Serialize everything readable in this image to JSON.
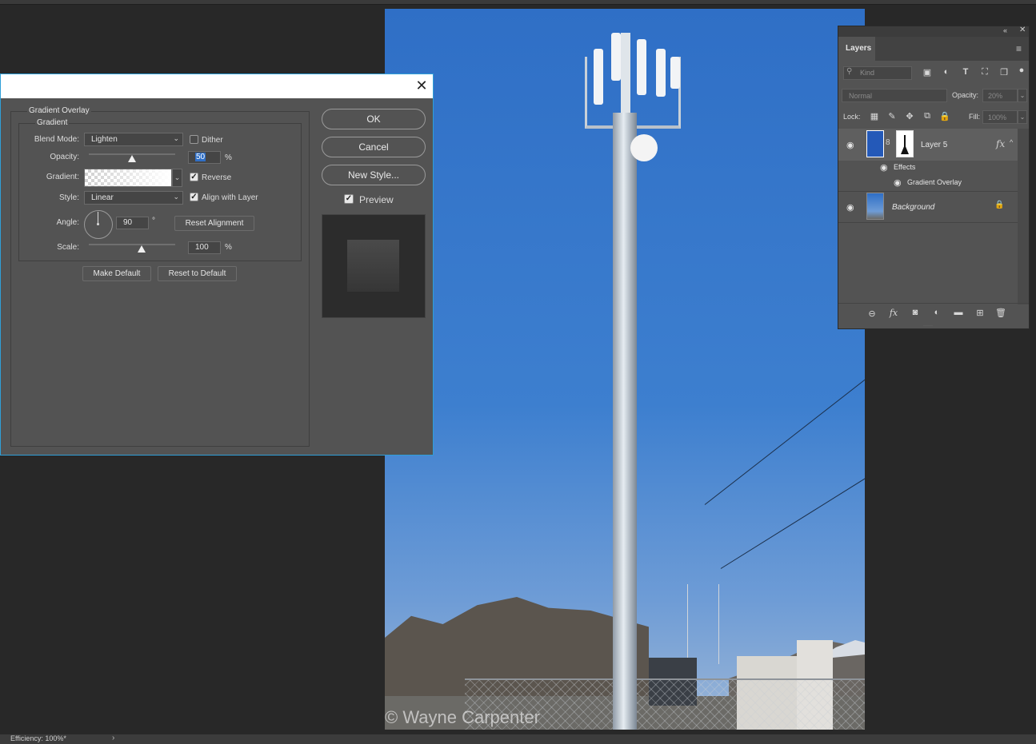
{
  "canvas": {
    "watermark": "© Wayne Carpenter"
  },
  "status_bar": {
    "efficiency": "Efficiency: 100%*",
    "arrow": "›"
  },
  "dialog": {
    "close": "✕",
    "section_title": "Gradient Overlay",
    "group_title": "Gradient",
    "blend_mode_label": "Blend Mode:",
    "blend_mode_value": "Lighten",
    "dither_label": "Dither",
    "dither_checked": false,
    "opacity_label": "Opacity:",
    "opacity_value": "50",
    "opacity_unit": "%",
    "opacity_slider_fraction": 0.5,
    "gradient_label": "Gradient:",
    "reverse_label": "Reverse",
    "reverse_checked": true,
    "style_label": "Style:",
    "style_value": "Linear",
    "align_label": "Align with Layer",
    "align_checked": true,
    "angle_label": "Angle:",
    "angle_value": "90",
    "angle_unit": "°",
    "reset_alignment": "Reset Alignment",
    "scale_label": "Scale:",
    "scale_value": "100",
    "scale_unit": "%",
    "make_default": "Make Default",
    "reset_to_default": "Reset to Default",
    "ok": "OK",
    "cancel": "Cancel",
    "new_style": "New Style...",
    "preview_label": "Preview",
    "preview_checked": true,
    "check_glyph": "✓",
    "caret": "⌄"
  },
  "layers_panel": {
    "tab": "Layers",
    "collapse": "«",
    "close": "✕",
    "menu": "≡",
    "kind_placeholder": "Kind",
    "search_glyph": "⚲",
    "blend_mode": "Normal",
    "opacity_label": "Opacity:",
    "opacity_value": "20%",
    "lock_label": "Lock:",
    "fill_label": "Fill:",
    "fill_value": "100%",
    "caret": "⌄",
    "eye": "◉",
    "layers": [
      {
        "name": "Layer 5",
        "fx": "fx",
        "expand": "^"
      },
      {
        "name": "Background",
        "lock": "🔒"
      }
    ],
    "effects_label": "Effects",
    "gradient_overlay_label": "Gradient Overlay",
    "chain": "8",
    "bottom_icons": [
      "link-icon",
      "fx-icon",
      "mask-icon",
      "adjustment-icon",
      "folder-icon",
      "new-layer-icon",
      "trash-icon"
    ],
    "filter_icons": [
      "image-filter-icon",
      "adjustment-filter-icon",
      "type-filter-icon",
      "shape-filter-icon",
      "smart-object-filter-icon"
    ],
    "lock_icons": [
      "lock-transparent-icon",
      "lock-paint-icon",
      "lock-move-icon",
      "lock-artboard-icon",
      "lock-all-icon"
    ]
  }
}
